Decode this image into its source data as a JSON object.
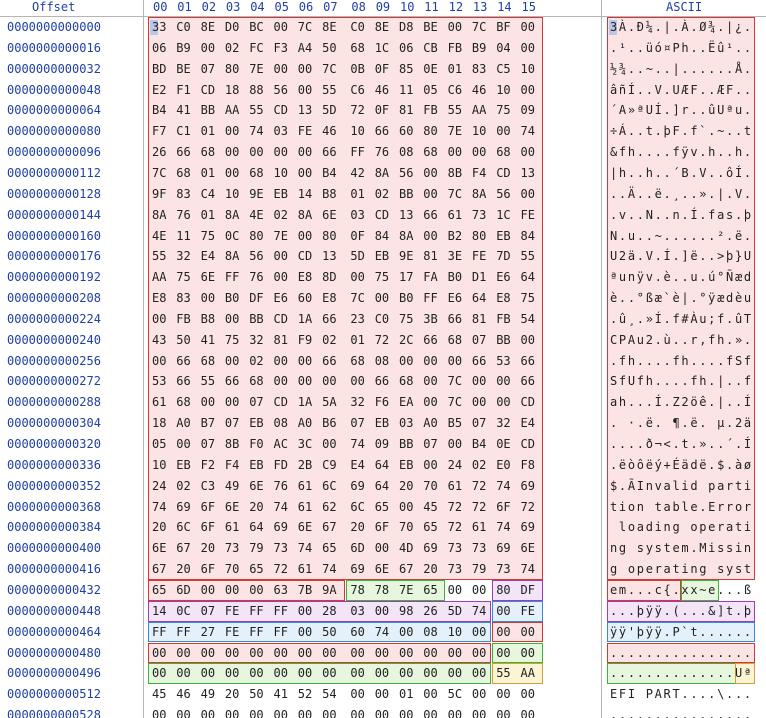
{
  "header": {
    "offset_label": "Offset",
    "columns": [
      "00",
      "01",
      "02",
      "03",
      "04",
      "05",
      "06",
      "07",
      "08",
      "09",
      "10",
      "11",
      "12",
      "13",
      "14",
      "15"
    ],
    "ascii_label": "ASCII"
  },
  "colors": {
    "mbr_code": "#fde4e4",
    "mbr_code_border": "#d23a3a",
    "disk_signature": "#e6f7dd",
    "disk_signature_border": "#3ab53a",
    "partition_entry_1": "#f3e4f7",
    "partition_entry_1_border": "#a53ab5",
    "partition_entry_2": "#e4f1fb",
    "partition_entry_2_border": "#3a8ad2",
    "partition_entry_3": "#fde4e4",
    "partition_entry_4": "#e6f7dd",
    "boot_signature": "#fdf4d6",
    "boot_signature_border": "#d2a13a"
  },
  "rows": [
    {
      "offset": "0000000000000",
      "hex": [
        "33",
        "C0",
        "8E",
        "D0",
        "BC",
        "00",
        "7C",
        "8E",
        "C0",
        "8E",
        "D8",
        "BE",
        "00",
        "7C",
        "BF",
        "00"
      ],
      "ascii": "3À.Ð¼.|.À.Ø¾.|¿."
    },
    {
      "offset": "0000000000016",
      "hex": [
        "06",
        "B9",
        "00",
        "02",
        "FC",
        "F3",
        "A4",
        "50",
        "68",
        "1C",
        "06",
        "CB",
        "FB",
        "B9",
        "04",
        "00"
      ],
      "ascii": ".¹..üó¤Ph..Ëû¹.."
    },
    {
      "offset": "0000000000032",
      "hex": [
        "BD",
        "BE",
        "07",
        "80",
        "7E",
        "00",
        "00",
        "7C",
        "0B",
        "0F",
        "85",
        "0E",
        "01",
        "83",
        "C5",
        "10"
      ],
      "ascii": "½¾..~..|......Å."
    },
    {
      "offset": "0000000000048",
      "hex": [
        "E2",
        "F1",
        "CD",
        "18",
        "88",
        "56",
        "00",
        "55",
        "C6",
        "46",
        "11",
        "05",
        "C6",
        "46",
        "10",
        "00"
      ],
      "ascii": "âñÍ..V.UÆF..ÆF.."
    },
    {
      "offset": "0000000000064",
      "hex": [
        "B4",
        "41",
        "BB",
        "AA",
        "55",
        "CD",
        "13",
        "5D",
        "72",
        "0F",
        "81",
        "FB",
        "55",
        "AA",
        "75",
        "09"
      ],
      "ascii": "´A»ªUÍ.]r..ûUªu."
    },
    {
      "offset": "0000000000080",
      "hex": [
        "F7",
        "C1",
        "01",
        "00",
        "74",
        "03",
        "FE",
        "46",
        "10",
        "66",
        "60",
        "80",
        "7E",
        "10",
        "00",
        "74"
      ],
      "ascii": "÷Á..t.þF.f`.~..t"
    },
    {
      "offset": "0000000000096",
      "hex": [
        "26",
        "66",
        "68",
        "00",
        "00",
        "00",
        "00",
        "66",
        "FF",
        "76",
        "08",
        "68",
        "00",
        "00",
        "68",
        "00"
      ],
      "ascii": "&fh....fÿv.h..h."
    },
    {
      "offset": "0000000000112",
      "hex": [
        "7C",
        "68",
        "01",
        "00",
        "68",
        "10",
        "00",
        "B4",
        "42",
        "8A",
        "56",
        "00",
        "8B",
        "F4",
        "CD",
        "13"
      ],
      "ascii": "|h..h..´B.V..ôÍ."
    },
    {
      "offset": "0000000000128",
      "hex": [
        "9F",
        "83",
        "C4",
        "10",
        "9E",
        "EB",
        "14",
        "B8",
        "01",
        "02",
        "BB",
        "00",
        "7C",
        "8A",
        "56",
        "00"
      ],
      "ascii": "..Ä..ë.¸..».|.V."
    },
    {
      "offset": "0000000000144",
      "hex": [
        "8A",
        "76",
        "01",
        "8A",
        "4E",
        "02",
        "8A",
        "6E",
        "03",
        "CD",
        "13",
        "66",
        "61",
        "73",
        "1C",
        "FE"
      ],
      "ascii": ".v..N..n.Í.fas.þ"
    },
    {
      "offset": "0000000000160",
      "hex": [
        "4E",
        "11",
        "75",
        "0C",
        "80",
        "7E",
        "00",
        "80",
        "0F",
        "84",
        "8A",
        "00",
        "B2",
        "80",
        "EB",
        "84"
      ],
      "ascii": "N.u..~......².ë."
    },
    {
      "offset": "0000000000176",
      "hex": [
        "55",
        "32",
        "E4",
        "8A",
        "56",
        "00",
        "CD",
        "13",
        "5D",
        "EB",
        "9E",
        "81",
        "3E",
        "FE",
        "7D",
        "55"
      ],
      "ascii": "U2ä.V.Í.]ë..>þ}U"
    },
    {
      "offset": "0000000000192",
      "hex": [
        "AA",
        "75",
        "6E",
        "FF",
        "76",
        "00",
        "E8",
        "8D",
        "00",
        "75",
        "17",
        "FA",
        "B0",
        "D1",
        "E6",
        "64"
      ],
      "ascii": "ªunÿv.è..u.ú°Ñæd"
    },
    {
      "offset": "0000000000208",
      "hex": [
        "E8",
        "83",
        "00",
        "B0",
        "DF",
        "E6",
        "60",
        "E8",
        "7C",
        "00",
        "B0",
        "FF",
        "E6",
        "64",
        "E8",
        "75"
      ],
      "ascii": "è..°ßæ`è|.°ÿædèu"
    },
    {
      "offset": "0000000000224",
      "hex": [
        "00",
        "FB",
        "B8",
        "00",
        "BB",
        "CD",
        "1A",
        "66",
        "23",
        "C0",
        "75",
        "3B",
        "66",
        "81",
        "FB",
        "54"
      ],
      "ascii": ".û¸.»Í.f#Àu;f.ûT"
    },
    {
      "offset": "0000000000240",
      "hex": [
        "43",
        "50",
        "41",
        "75",
        "32",
        "81",
        "F9",
        "02",
        "01",
        "72",
        "2C",
        "66",
        "68",
        "07",
        "BB",
        "00"
      ],
      "ascii": "CPAu2.ù..r,fh.»."
    },
    {
      "offset": "0000000000256",
      "hex": [
        "00",
        "66",
        "68",
        "00",
        "02",
        "00",
        "00",
        "66",
        "68",
        "08",
        "00",
        "00",
        "00",
        "66",
        "53",
        "66"
      ],
      "ascii": ".fh....fh....fSf"
    },
    {
      "offset": "0000000000272",
      "hex": [
        "53",
        "66",
        "55",
        "66",
        "68",
        "00",
        "00",
        "00",
        "00",
        "66",
        "68",
        "00",
        "7C",
        "00",
        "00",
        "66"
      ],
      "ascii": "SfUfh....fh.|..f"
    },
    {
      "offset": "0000000000288",
      "hex": [
        "61",
        "68",
        "00",
        "00",
        "07",
        "CD",
        "1A",
        "5A",
        "32",
        "F6",
        "EA",
        "00",
        "7C",
        "00",
        "00",
        "CD"
      ],
      "ascii": "ah...Í.Z2öê.|..Í"
    },
    {
      "offset": "0000000000304",
      "hex": [
        "18",
        "A0",
        "B7",
        "07",
        "EB",
        "08",
        "A0",
        "B6",
        "07",
        "EB",
        "03",
        "A0",
        "B5",
        "07",
        "32",
        "E4"
      ],
      "ascii": ". ·.ë. ¶.ë. µ.2ä"
    },
    {
      "offset": "0000000000320",
      "hex": [
        "05",
        "00",
        "07",
        "8B",
        "F0",
        "AC",
        "3C",
        "00",
        "74",
        "09",
        "BB",
        "07",
        "00",
        "B4",
        "0E",
        "CD"
      ],
      "ascii": "....ð¬<.t.»..´.Í"
    },
    {
      "offset": "0000000000336",
      "hex": [
        "10",
        "EB",
        "F2",
        "F4",
        "EB",
        "FD",
        "2B",
        "C9",
        "E4",
        "64",
        "EB",
        "00",
        "24",
        "02",
        "E0",
        "F8"
      ],
      "ascii": ".ëòôëý+Éädë.$.àø"
    },
    {
      "offset": "0000000000352",
      "hex": [
        "24",
        "02",
        "C3",
        "49",
        "6E",
        "76",
        "61",
        "6C",
        "69",
        "64",
        "20",
        "70",
        "61",
        "72",
        "74",
        "69"
      ],
      "ascii": "$.ÃInvalid parti"
    },
    {
      "offset": "0000000000368",
      "hex": [
        "74",
        "69",
        "6F",
        "6E",
        "20",
        "74",
        "61",
        "62",
        "6C",
        "65",
        "00",
        "45",
        "72",
        "72",
        "6F",
        "72"
      ],
      "ascii": "tion table.Error"
    },
    {
      "offset": "0000000000384",
      "hex": [
        "20",
        "6C",
        "6F",
        "61",
        "64",
        "69",
        "6E",
        "67",
        "20",
        "6F",
        "70",
        "65",
        "72",
        "61",
        "74",
        "69"
      ],
      "ascii": " loading operati"
    },
    {
      "offset": "0000000000400",
      "hex": [
        "6E",
        "67",
        "20",
        "73",
        "79",
        "73",
        "74",
        "65",
        "6D",
        "00",
        "4D",
        "69",
        "73",
        "73",
        "69",
        "6E"
      ],
      "ascii": "ng system.Missin"
    },
    {
      "offset": "0000000000416",
      "hex": [
        "67",
        "20",
        "6F",
        "70",
        "65",
        "72",
        "61",
        "74",
        "69",
        "6E",
        "67",
        "20",
        "73",
        "79",
        "73",
        "74"
      ],
      "ascii": "g operating syst"
    },
    {
      "offset": "0000000000432",
      "hex": [
        "65",
        "6D",
        "00",
        "00",
        "00",
        "63",
        "7B",
        "9A",
        "78",
        "78",
        "7E",
        "65",
        "00",
        "00",
        "80",
        "DF"
      ],
      "ascii": "em...c{.xx~e...ß"
    },
    {
      "offset": "0000000000448",
      "hex": [
        "14",
        "0C",
        "07",
        "FE",
        "FF",
        "FF",
        "00",
        "28",
        "03",
        "00",
        "98",
        "26",
        "5D",
        "74",
        "00",
        "FE"
      ],
      "ascii": "...þÿÿ.(...&]t.þ"
    },
    {
      "offset": "0000000000464",
      "hex": [
        "FF",
        "FF",
        "27",
        "FE",
        "FF",
        "FF",
        "00",
        "50",
        "60",
        "74",
        "00",
        "08",
        "10",
        "00",
        "00",
        "00"
      ],
      "ascii": "ÿÿ'þÿÿ.P`t......"
    },
    {
      "offset": "0000000000480",
      "hex": [
        "00",
        "00",
        "00",
        "00",
        "00",
        "00",
        "00",
        "00",
        "00",
        "00",
        "00",
        "00",
        "00",
        "00",
        "00",
        "00"
      ],
      "ascii": "................"
    },
    {
      "offset": "0000000000496",
      "hex": [
        "00",
        "00",
        "00",
        "00",
        "00",
        "00",
        "00",
        "00",
        "00",
        "00",
        "00",
        "00",
        "00",
        "00",
        "55",
        "AA"
      ],
      "ascii": "..............Uª"
    },
    {
      "offset": "0000000000512",
      "hex": [
        "45",
        "46",
        "49",
        "20",
        "50",
        "41",
        "52",
        "54",
        "00",
        "00",
        "01",
        "00",
        "5C",
        "00",
        "00",
        "00"
      ],
      "ascii": "EFI PART....\\..."
    },
    {
      "offset": "0000000000528",
      "hex": [
        "00",
        "00",
        "00",
        "00",
        "00",
        "00",
        "00",
        "00",
        "00",
        "00",
        "00",
        "00",
        "00",
        "00",
        "00",
        "00"
      ],
      "ascii": "................"
    }
  ]
}
